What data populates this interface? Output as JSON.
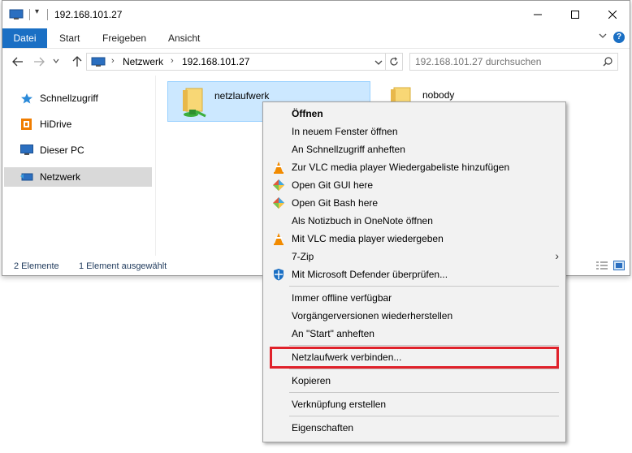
{
  "window": {
    "title": "192.168.101.27",
    "qa_arrow": "▾"
  },
  "ribbon": {
    "tabs": [
      "Datei",
      "Start",
      "Freigeben",
      "Ansicht"
    ],
    "help": "?"
  },
  "address": {
    "crumbs": [
      "Netzwerk",
      "192.168.101.27"
    ],
    "separator": "›"
  },
  "search": {
    "placeholder": "192.168.101.27 durchsuchen"
  },
  "nav_pane": {
    "items": [
      {
        "label": "Schnellzugriff",
        "icon": "star-icon",
        "selected": false
      },
      {
        "label": "HiDrive",
        "icon": "hidrive-icon",
        "selected": false
      },
      {
        "label": "Dieser PC",
        "icon": "pc-icon",
        "selected": false
      },
      {
        "label": "Netzwerk",
        "icon": "network-icon",
        "selected": true
      }
    ]
  },
  "content": {
    "items": [
      {
        "label": "netzlaufwerk",
        "icon": "shared-folder-icon",
        "selected": true
      },
      {
        "label": "nobody",
        "icon": "folder-icon",
        "selected": false
      }
    ]
  },
  "status": {
    "count": "2 Elemente",
    "selection": "1 Element ausgewählt"
  },
  "context_menu": {
    "items": [
      {
        "label": "Öffnen",
        "bold": true,
        "icon": ""
      },
      {
        "label": "In neuem Fenster öffnen",
        "icon": ""
      },
      {
        "label": "An Schnellzugriff anheften",
        "icon": ""
      },
      {
        "label": "Zur VLC media player Wiedergabeliste hinzufügen",
        "icon": "vlc-icon"
      },
      {
        "label": "Open Git GUI here",
        "icon": "git-icon"
      },
      {
        "label": "Open Git Bash here",
        "icon": "git-icon"
      },
      {
        "label": "Als Notizbuch in OneNote öffnen",
        "icon": ""
      },
      {
        "label": "Mit VLC media player wiedergeben",
        "icon": "vlc-icon"
      },
      {
        "label": "7-Zip",
        "icon": "",
        "submenu": true
      },
      {
        "label": "Mit Microsoft Defender überprüfen...",
        "icon": "defender-icon"
      },
      {
        "label": "Immer offline verfügbar",
        "icon": ""
      },
      {
        "label": "Vorgängerversionen wiederherstellen",
        "icon": ""
      },
      {
        "label": "An \"Start\" anheften",
        "icon": ""
      },
      {
        "label": "Netzlaufwerk verbinden...",
        "icon": "",
        "highlighted": true
      },
      {
        "label": "Kopieren",
        "icon": ""
      },
      {
        "label": "Verknüpfung erstellen",
        "icon": ""
      },
      {
        "label": "Eigenschaften",
        "icon": ""
      }
    ],
    "submenu_arrow": "›"
  },
  "colors": {
    "accent": "#1a6fc4",
    "highlight_border": "#e0212a",
    "selection_bg": "#cce8ff",
    "status_text": "#1e395b"
  }
}
